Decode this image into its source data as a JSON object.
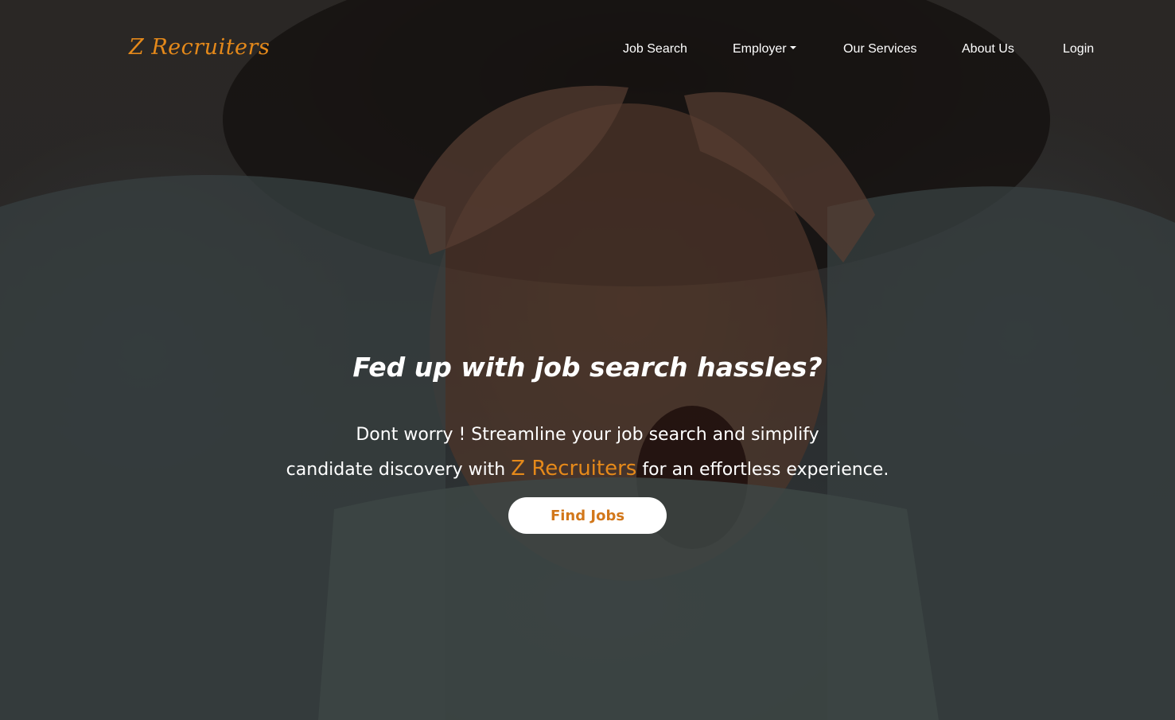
{
  "brand": {
    "name": "Z Recruiters",
    "color": "#e5891a"
  },
  "nav": {
    "items": [
      {
        "label": "Job Search"
      },
      {
        "label": "Employer",
        "has_dropdown": true
      },
      {
        "label": "Our Services"
      },
      {
        "label": "About Us"
      },
      {
        "label": "Login"
      }
    ]
  },
  "hero": {
    "headline": "Fed up with job search hassles?",
    "sub_line1": "Dont worry ! Streamline your job search and simplify",
    "sub_line2_before": "candidate discovery with ",
    "sub_line2_brand": "Z Recruiters",
    "sub_line2_after": " for an effortless experience.",
    "cta_label": "Find Jobs",
    "cta_text_color": "#d2771a",
    "background_image": "woman-with-hands-on-head-photo"
  }
}
